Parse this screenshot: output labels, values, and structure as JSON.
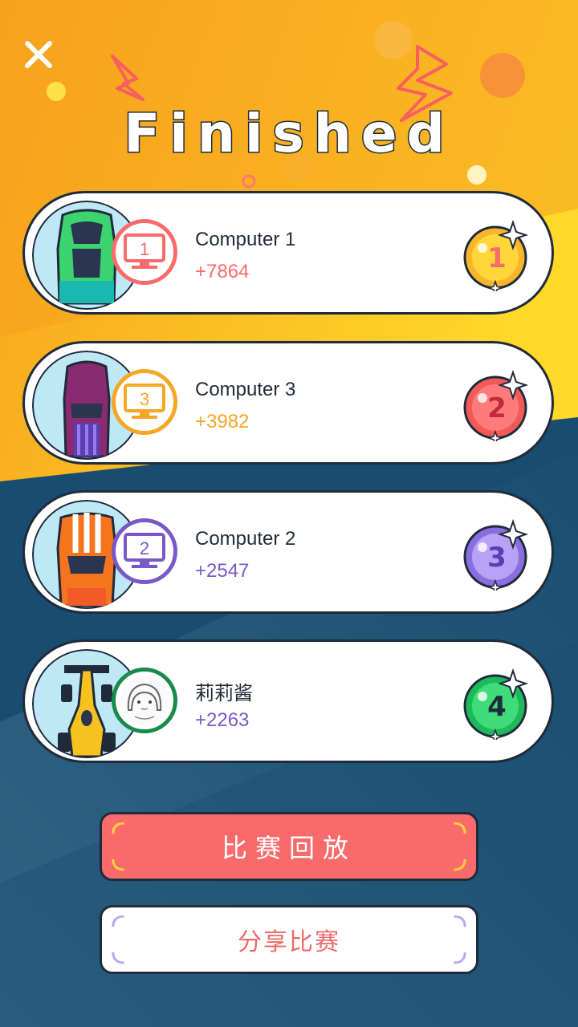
{
  "header": {
    "title": "Finished",
    "close_icon": "close-icon"
  },
  "colors": {
    "orange": "#f6a623",
    "yellow": "#ffd41f",
    "navy": "#1a4e72",
    "red": "#f96b6b",
    "gold": "#f5a623",
    "purple": "#7a58c7",
    "green": "#1a8a4a"
  },
  "results": [
    {
      "rank": "1",
      "name": "Computer 1",
      "score": "+7864",
      "avatar_label": "1",
      "car": "green-sports-car"
    },
    {
      "rank": "2",
      "name": "Computer 3",
      "score": "+3982",
      "avatar_label": "3",
      "car": "purple-sedan-car"
    },
    {
      "rank": "3",
      "name": "Computer 2",
      "score": "+2547",
      "avatar_label": "2",
      "car": "orange-muscle-car"
    },
    {
      "rank": "4",
      "name": "莉莉酱",
      "score": "+2263",
      "avatar_label": "",
      "car": "yellow-formula-car"
    }
  ],
  "buttons": {
    "replay": "比赛回放",
    "share": "分享比赛"
  }
}
